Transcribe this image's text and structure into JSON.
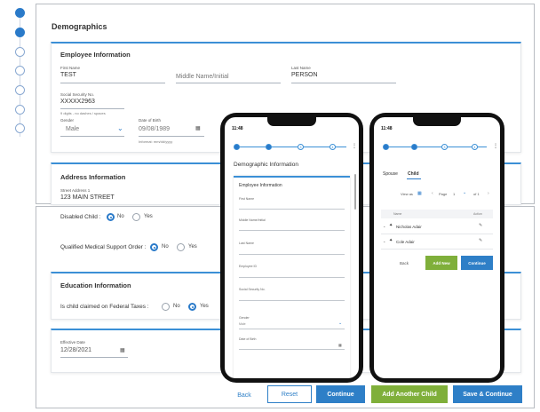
{
  "steps": [
    "",
    "",
    "",
    "",
    "",
    "",
    ""
  ],
  "page_title": "Demographics",
  "employee": {
    "title": "Employee Information",
    "first_name_label": "First Name",
    "first_name": "TEST",
    "middle_placeholder": "Middle Name/Initial",
    "last_name_label": "Last Name",
    "last_name": "PERSON",
    "ssn_label": "Social Security No.",
    "ssn": "XXXXX2963",
    "ssn_hint": "9 digits - no dashes / spaces",
    "gender_label": "Gender",
    "gender": "Male",
    "dob_label": "Date of Birth",
    "dob": "09/08/1989",
    "dob_hint": "Informat: mm/dd/yyyy"
  },
  "address": {
    "title": "Address Information",
    "street_label": "Street Address 1",
    "street": "123 MAIN STREET"
  },
  "child": {
    "disabled_label": "Disabled Child :",
    "no": "No",
    "yes": "Yes",
    "qmso_label": "Qualified Medical Support Order :"
  },
  "education": {
    "title": "Education Information",
    "claimed_label": "Is child claimed on Federal Taxes :"
  },
  "effective": {
    "label": "Effective Date",
    "value": "12/28/2021"
  },
  "buttons": {
    "back": "Back",
    "reset": "Reset",
    "continue": "Continue",
    "add_child": "Add Another Child",
    "save_continue": "Save & Continue"
  },
  "phone1": {
    "time": "11:48",
    "steps": [
      "",
      "",
      "3",
      "4"
    ],
    "title": "Demographic Information",
    "section": "Employee Information",
    "fields": [
      "First Name",
      "Middle Name/Initial",
      "Last Name",
      "Employee ID",
      "Social Security No.",
      "",
      "Gender",
      "Date of Birth"
    ],
    "gender_value": "Male"
  },
  "phone2": {
    "time": "11:48",
    "steps": [
      "",
      "",
      "3",
      "4"
    ],
    "tab_spouse": "Spouse",
    "tab_child": "Child",
    "view_label": "View as",
    "page_label": "Page",
    "page_num": "1",
    "page_of": "of 1",
    "col_name": "Name",
    "col_action": "Action",
    "children": [
      "Nicholas Adair",
      "Cole Adair"
    ],
    "back": "Back",
    "add_new": "Add New",
    "continue": "Continue"
  }
}
